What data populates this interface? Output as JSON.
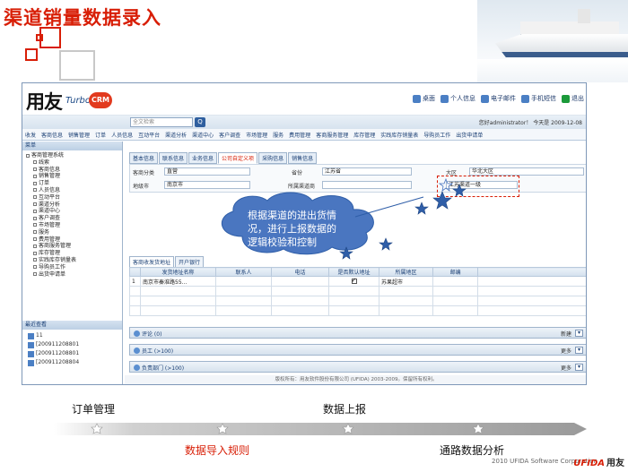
{
  "slide": {
    "title": "渠道销量数据录入"
  },
  "app": {
    "logo_text": "用友",
    "logo_turbo": "Turbo",
    "logo_crm": "CRM",
    "topnav": [
      "桌面",
      "个人信息",
      "电子邮件",
      "手机短信",
      "退出"
    ],
    "search_placeholder": "全文检索",
    "search_button": "Q",
    "user_info": "您好administrator！ 今天是 2009-12-08",
    "menu": [
      "收发",
      "客商信息",
      "销售管理",
      "订单",
      "人员信息",
      "互动平台",
      "渠道分析",
      "渠道中心",
      "客户调查",
      "市场管理",
      "服务",
      "费用管理",
      "客商服务管理",
      "库存管理",
      "实践库存销量表",
      "导购员工作",
      "出货申请单"
    ],
    "sidebar": {
      "header": "菜单",
      "tree": [
        {
          "label": "客商管理系统",
          "sub": false
        },
        {
          "label": "线索",
          "sub": true
        },
        {
          "label": "客商信息",
          "sub": true
        },
        {
          "label": "销售管理",
          "sub": true
        },
        {
          "label": "订单",
          "sub": true
        },
        {
          "label": "人员信息",
          "sub": true
        },
        {
          "label": "互动平台",
          "sub": true
        },
        {
          "label": "渠道分析",
          "sub": true
        },
        {
          "label": "渠道中心",
          "sub": true
        },
        {
          "label": "客户调查",
          "sub": true
        },
        {
          "label": "市场管理",
          "sub": true
        },
        {
          "label": "服务",
          "sub": true
        },
        {
          "label": "费用管理",
          "sub": true
        },
        {
          "label": "客商服务管理",
          "sub": true
        },
        {
          "label": "库存管理",
          "sub": true
        },
        {
          "label": "实践库存销量表",
          "sub": true
        },
        {
          "label": "导购员工作",
          "sub": true
        },
        {
          "label": "出货申请单",
          "sub": true
        }
      ],
      "recent_header": "最近查看",
      "recent": [
        "11",
        "[200911208801",
        "[200911208801",
        "[200911208804"
      ]
    },
    "tabs": [
      "基本信息",
      "联系信息",
      "业务信息",
      "公司自定义项",
      "采购信息",
      "销售信息"
    ],
    "form": {
      "customer_class_label": "客商分类",
      "customer_class_value": "直营",
      "province_label": "省份",
      "province_value": "江苏省",
      "region_label": "大区",
      "region_value": "华北大区",
      "city_label": "地级市",
      "city_value": "南京市",
      "channel_label": "所属渠道商",
      "channel_value": "江苏渠道一级"
    },
    "subtabs": [
      "客商收发货地址",
      "开户银行"
    ],
    "grid": {
      "headers": [
        "",
        "发货地址名称",
        "联系人",
        "电话",
        "是否默认地址",
        "所属地区",
        "邮编"
      ],
      "rows": [
        {
          "no": "1",
          "name": "南京市秦淮路55...",
          "contact": "",
          "phone": "",
          "default": true,
          "region": "苏果超市",
          "zip": ""
        }
      ]
    },
    "panels": [
      {
        "title": "评论 (0)",
        "action": "新建"
      },
      {
        "title": "员工 (>100)",
        "action": "更多"
      },
      {
        "title": "负责部门 (>100)",
        "action": "更多"
      }
    ],
    "footer": "版权所有：用友软件股份有限公司 (UFIDA) 2003-2009。保留所有权利。"
  },
  "callout": {
    "line1": "根据渠道的进出货情",
    "line2": "况，进行上报数据的",
    "line3": "逻辑校验和控制"
  },
  "timeline": {
    "top_labels": [
      "订单管理",
      "数据上报"
    ],
    "bottom_labels": [
      "数据导入规则",
      "通路数据分析"
    ],
    "copyright": "2010 UFIDA Software Corporation",
    "brand_ufida": "UFIDA",
    "brand_yy": "用友"
  },
  "colors": {
    "accent_red": "#d81e06",
    "cloud_blue": "#4a76c0",
    "star_blue": "#2f5ea8"
  }
}
